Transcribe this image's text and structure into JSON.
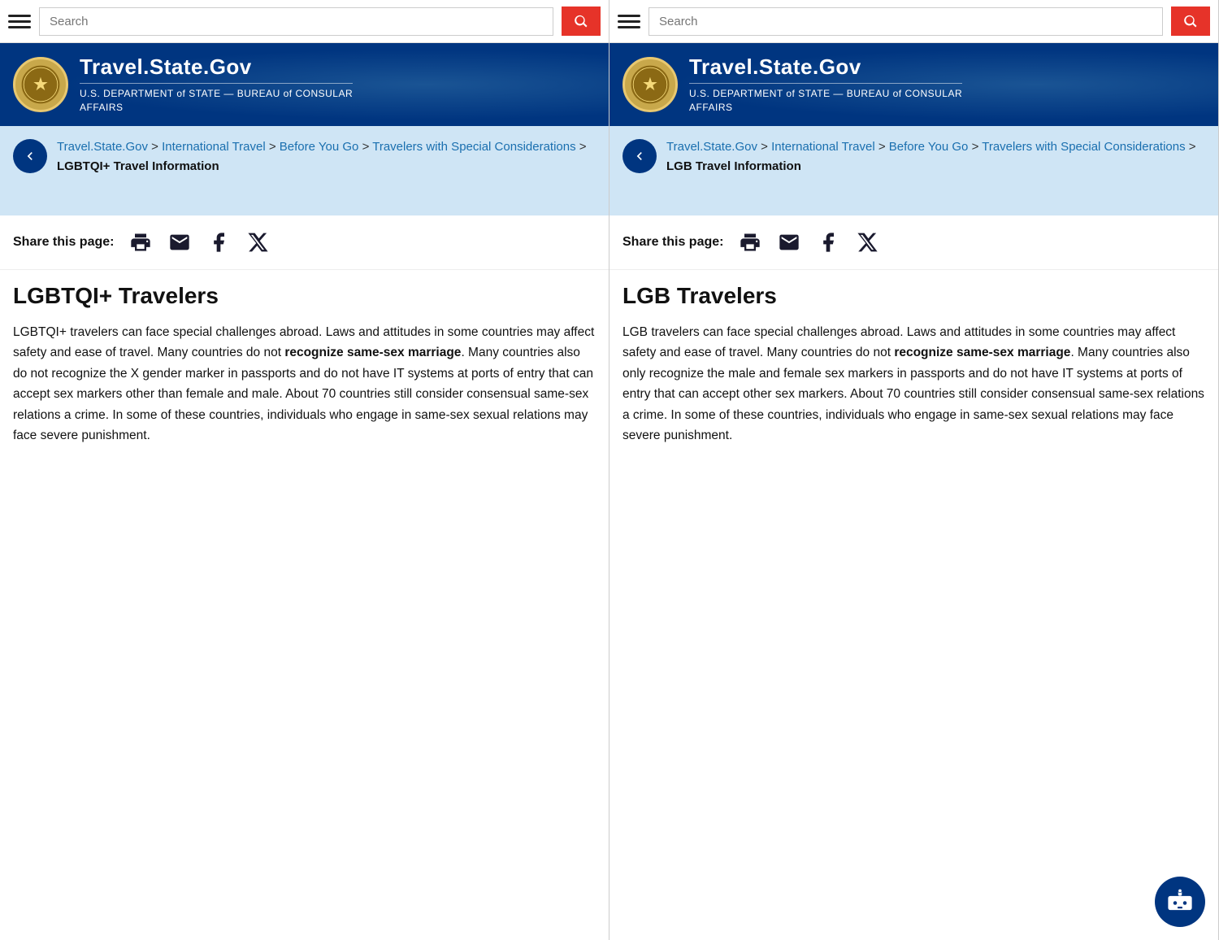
{
  "panels": [
    {
      "id": "panel-left",
      "nav": {
        "search_placeholder": "Search",
        "search_button_label": "Search"
      },
      "header": {
        "seal_emoji": "🦅",
        "site_title": "Travel.State.Gov",
        "subtitle_line1": "U.S. DEPARTMENT of STATE — BUREAU of CONSULAR",
        "subtitle_line2": "AFFAIRS"
      },
      "breadcrumb": {
        "links": [
          {
            "text": "Travel.State.Gov",
            "href": "#"
          },
          {
            "text": "International Travel",
            "href": "#"
          },
          {
            "text": "Before You Go",
            "href": "#"
          },
          {
            "text": "Travelers with Special Considerations",
            "href": "#"
          }
        ],
        "current": "LGBTQI+ Travel Information"
      },
      "share": {
        "label": "Share this page:"
      },
      "content": {
        "heading": "LGBTQI+ Travelers",
        "body_html": "LGBTQI+ travelers can face special challenges abroad. Laws and attitudes in some countries may affect safety and ease of travel. Many countries do not <strong>recognize same-sex marriage</strong>. Many countries also do not recognize the X gender marker in passports and do not have IT systems at ports of entry that can accept sex markers other than female and male. About 70 countries still consider consensual same-sex relations a crime. In some of these countries, individuals who engage in same-sex sexual relations may face severe punishment."
      }
    },
    {
      "id": "panel-right",
      "nav": {
        "search_placeholder": "Search",
        "search_button_label": "Search"
      },
      "header": {
        "seal_emoji": "🦅",
        "site_title": "Travel.State.Gov",
        "subtitle_line1": "U.S. DEPARTMENT of STATE — BUREAU of CONSULAR",
        "subtitle_line2": "AFFAIRS"
      },
      "breadcrumb": {
        "links": [
          {
            "text": "Travel.State.Gov",
            "href": "#"
          },
          {
            "text": "International Travel",
            "href": "#"
          },
          {
            "text": "Before You Go",
            "href": "#"
          },
          {
            "text": "Travelers with Special Considerations",
            "href": "#"
          }
        ],
        "current": "LGB Travel Information"
      },
      "share": {
        "label": "Share this page:"
      },
      "content": {
        "heading": "LGB Travelers",
        "body_html": "LGB travelers can face special challenges abroad. Laws and attitudes in some countries may affect safety and ease of travel. Many countries do not <strong>recognize same-sex marriage</strong>. Many countries also only recognize the male and female sex markers in passports and do not have IT systems at ports of entry that can accept other sex markers. About 70 countries still consider consensual same-sex relations a crime. In some of these countries, individuals who engage in same-sex sexual relations may face severe punishment."
      }
    }
  ]
}
